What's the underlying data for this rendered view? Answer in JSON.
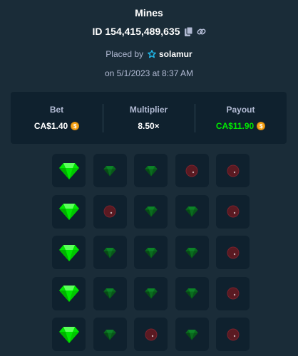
{
  "header": {
    "title": "Mines",
    "id_text": "ID 154,415,489,635",
    "placed_by_label": "Placed by",
    "username": "solamur",
    "date_text": "on 5/1/2023 at 8:37 AM"
  },
  "stats": {
    "bet_label": "Bet",
    "bet_value": "CA$1.40",
    "multiplier_label": "Multiplier",
    "multiplier_value": "8.50×",
    "payout_label": "Payout",
    "payout_value": "CA$11.90",
    "coin_symbol": "$"
  },
  "colors": {
    "background": "#1a2c38",
    "panel": "#0f212e",
    "gem_bright": "#00e701",
    "gem_dim": "#0a6b1f",
    "mine": "#5a1a22",
    "payout": "#00e701",
    "coin": "#f6a316"
  },
  "grid": {
    "rows": [
      [
        "gem-revealed",
        "gem",
        "gem",
        "mine",
        "mine"
      ],
      [
        "gem-revealed",
        "mine",
        "gem",
        "gem",
        "mine"
      ],
      [
        "gem-revealed",
        "gem",
        "gem",
        "gem",
        "mine"
      ],
      [
        "gem-revealed",
        "gem",
        "gem",
        "gem",
        "mine"
      ],
      [
        "gem-revealed",
        "gem",
        "mine",
        "gem",
        "mine"
      ]
    ]
  }
}
